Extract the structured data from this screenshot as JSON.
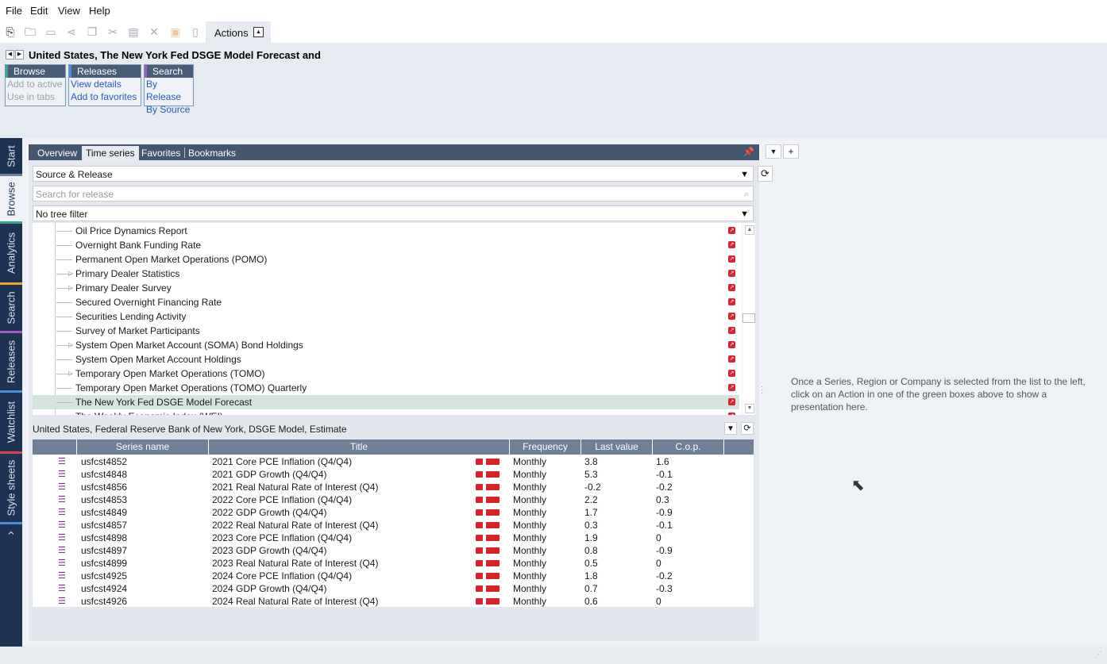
{
  "menu": [
    "File",
    "Edit",
    "View",
    "Help"
  ],
  "toolbar": {
    "actions_label": "Actions",
    "actions_toggle": "▲"
  },
  "header": {
    "title": "United States, The New York Fed DSGE Model Forecast and",
    "boxes": [
      {
        "title": "Browse",
        "color": "#3aa58b",
        "links": [
          {
            "label": "Add to active",
            "enabled": false
          },
          {
            "label": "Use in tabs",
            "enabled": false
          }
        ]
      },
      {
        "title": "Releases",
        "color": "#4a90d9",
        "links": [
          {
            "label": "View details",
            "enabled": true
          },
          {
            "label": "Add to favorites",
            "enabled": true
          }
        ]
      },
      {
        "title": "Search",
        "color": "#a05ac8",
        "links": [
          {
            "label": "By Release",
            "enabled": true
          },
          {
            "label": "By Source",
            "enabled": true
          }
        ]
      }
    ]
  },
  "rail": {
    "tabs": [
      "Start",
      "Browse",
      "Analytics",
      "Search",
      "Releases",
      "Watchlist",
      "Style sheets"
    ],
    "selected": "Browse",
    "more": "›"
  },
  "panel": {
    "tabs": [
      "Overview",
      "Time series",
      "Favorites",
      "Bookmarks"
    ],
    "selected_tab": "Time series",
    "source_combo": "Source & Release",
    "search_placeholder": "Search for release",
    "tree_filter": "No tree filter",
    "tree_items": [
      {
        "label": "Oil Price Dynamics Report",
        "expandable": false
      },
      {
        "label": "Overnight Bank Funding Rate",
        "expandable": false
      },
      {
        "label": "Permanent Open Market Operations (POMO)",
        "expandable": false
      },
      {
        "label": "Primary Dealer Statistics",
        "expandable": true
      },
      {
        "label": "Primary Dealer Survey",
        "expandable": true
      },
      {
        "label": "Secured Overnight Financing Rate",
        "expandable": false
      },
      {
        "label": "Securities Lending Activity",
        "expandable": false
      },
      {
        "label": "Survey of Market Participants",
        "expandable": false
      },
      {
        "label": "System Open Market Account (SOMA) Bond Holdings",
        "expandable": true
      },
      {
        "label": "System Open Market Account Holdings",
        "expandable": false
      },
      {
        "label": "Temporary Open Market Operations (TOMO)",
        "expandable": true
      },
      {
        "label": "Temporary Open Market Operations (TOMO) Quarterly",
        "expandable": false
      },
      {
        "label": "The New York Fed DSGE Model Forecast",
        "expandable": false,
        "selected": true
      },
      {
        "label": "The Weekly Economic Index (WEI)",
        "expandable": false
      }
    ],
    "series_crumb": "United States, Federal Reserve Bank of New York, DSGE Model, Estimate",
    "columns": [
      "Series name",
      "Title",
      "Frequency",
      "Last value",
      "C.o.p."
    ],
    "rows": [
      {
        "name": "usfcst4852",
        "title": "2021 Core PCE Inflation (Q4/Q4)",
        "freq": "Monthly",
        "last": "3.8",
        "cop": "1.6"
      },
      {
        "name": "usfcst4848",
        "title": "2021 GDP Growth (Q4/Q4)",
        "freq": "Monthly",
        "last": "5.3",
        "cop": "-0.1"
      },
      {
        "name": "usfcst4856",
        "title": "2021 Real Natural Rate of Interest (Q4)",
        "freq": "Monthly",
        "last": "-0.2",
        "cop": "-0.2"
      },
      {
        "name": "usfcst4853",
        "title": "2022 Core PCE Inflation (Q4/Q4)",
        "freq": "Monthly",
        "last": "2.2",
        "cop": "0.3"
      },
      {
        "name": "usfcst4849",
        "title": "2022 GDP Growth (Q4/Q4)",
        "freq": "Monthly",
        "last": "1.7",
        "cop": "-0.9"
      },
      {
        "name": "usfcst4857",
        "title": "2022 Real Natural Rate of Interest (Q4)",
        "freq": "Monthly",
        "last": "0.3",
        "cop": "-0.1"
      },
      {
        "name": "usfcst4898",
        "title": "2023 Core PCE Inflation (Q4/Q4)",
        "freq": "Monthly",
        "last": "1.9",
        "cop": "0"
      },
      {
        "name": "usfcst4897",
        "title": "2023 GDP Growth (Q4/Q4)",
        "freq": "Monthly",
        "last": "0.8",
        "cop": "-0.9"
      },
      {
        "name": "usfcst4899",
        "title": "2023 Real Natural Rate of Interest (Q4)",
        "freq": "Monthly",
        "last": "0.5",
        "cop": "0"
      },
      {
        "name": "usfcst4925",
        "title": "2024 Core PCE Inflation (Q4/Q4)",
        "freq": "Monthly",
        "last": "1.8",
        "cop": "-0.2"
      },
      {
        "name": "usfcst4924",
        "title": "2024 GDP Growth (Q4/Q4)",
        "freq": "Monthly",
        "last": "0.7",
        "cop": "-0.3"
      },
      {
        "name": "usfcst4926",
        "title": "2024 Real Natural Rate of Interest (Q4)",
        "freq": "Monthly",
        "last": "0.6",
        "cop": "0"
      }
    ]
  },
  "right": {
    "hint": "Once a Series, Region or Company is selected from the list to the left, click on an Action in one of the green boxes above to show a presentation here."
  }
}
